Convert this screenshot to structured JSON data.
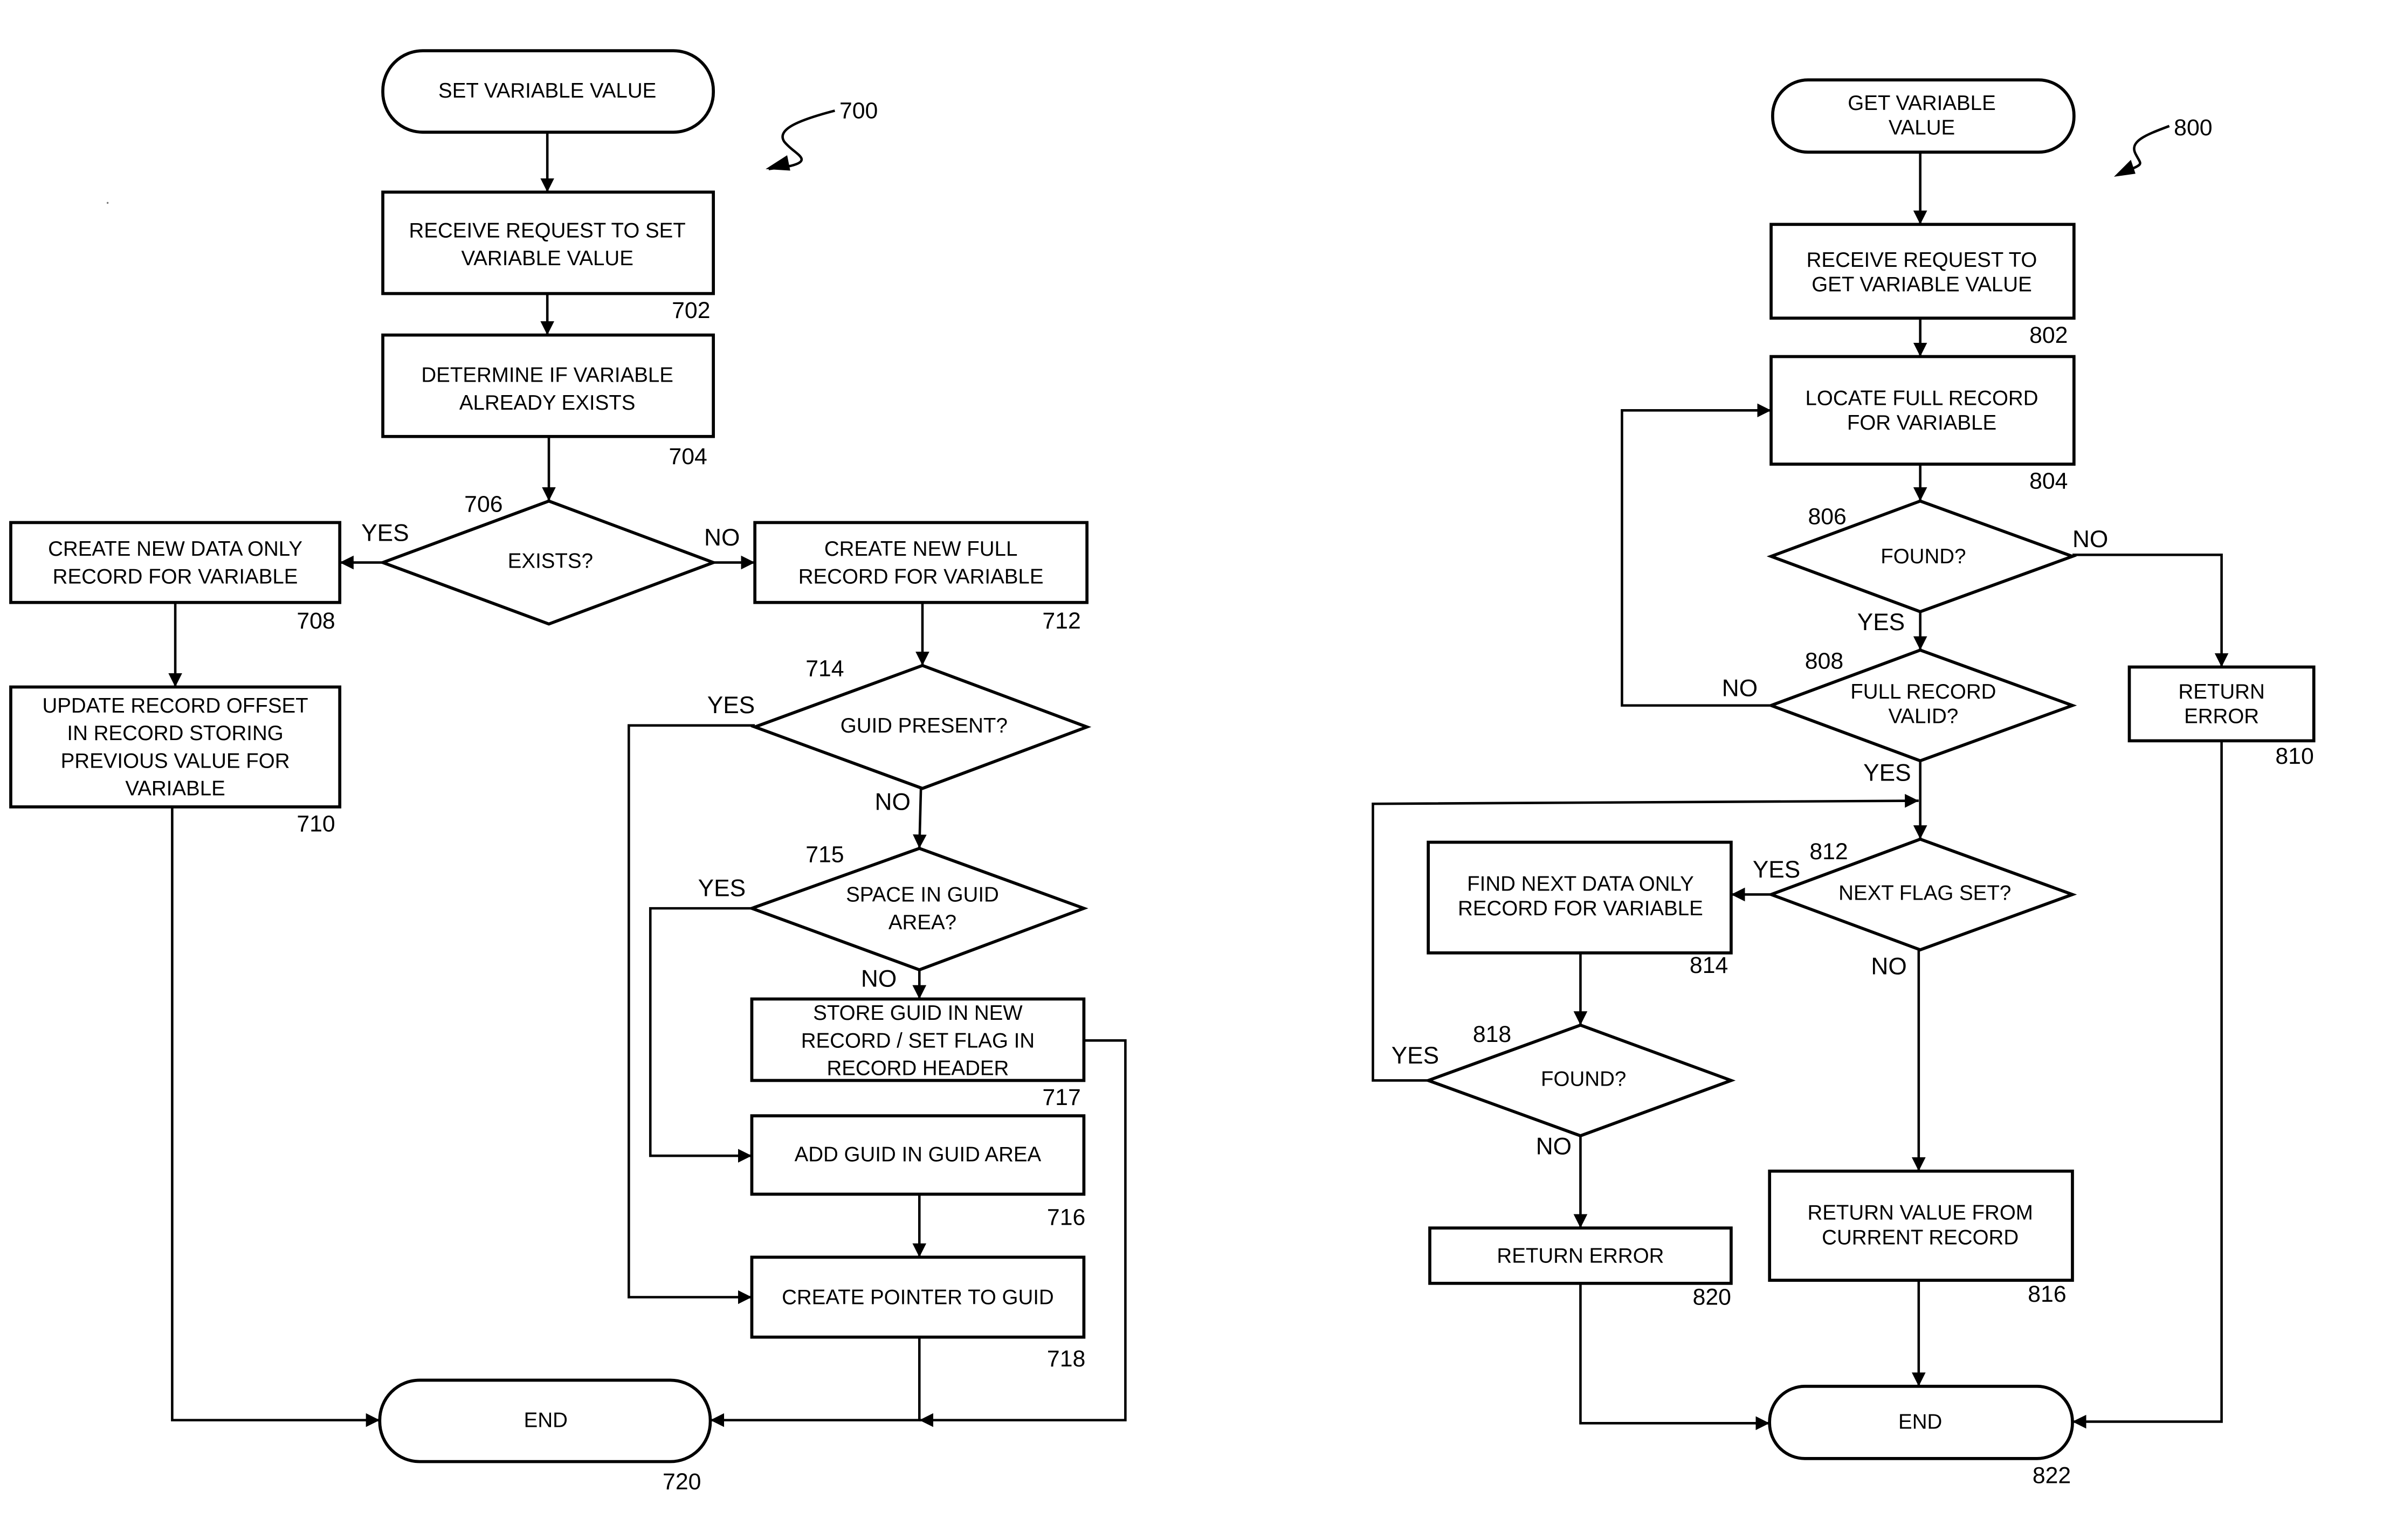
{
  "figures": [
    {
      "id": "700",
      "ref_label": "700",
      "nodes": {
        "start": {
          "text": [
            "SET VARIABLE VALUE"
          ]
        },
        "n702": {
          "text": [
            "RECEIVE REQUEST TO SET",
            "VARIABLE VALUE"
          ],
          "ref": "702"
        },
        "n704": {
          "text": [
            "DETERMINE IF VARIABLE",
            "ALREADY EXISTS"
          ],
          "ref": "704"
        },
        "n706": {
          "text": [
            "EXISTS?"
          ],
          "ref": "706"
        },
        "n708": {
          "text": [
            "CREATE NEW DATA ONLY",
            "RECORD FOR VARIABLE"
          ],
          "ref": "708"
        },
        "n710": {
          "text": [
            "UPDATE RECORD OFFSET",
            "IN RECORD STORING",
            "PREVIOUS VALUE FOR",
            "VARIABLE"
          ],
          "ref": "710"
        },
        "n712": {
          "text": [
            "CREATE NEW FULL",
            "RECORD FOR VARIABLE"
          ],
          "ref": "712"
        },
        "n714": {
          "text": [
            "GUID PRESENT?"
          ],
          "ref": "714"
        },
        "n715": {
          "text": [
            "SPACE IN GUID",
            "AREA?"
          ],
          "ref": "715"
        },
        "n717": {
          "text": [
            "STORE GUID IN NEW",
            "RECORD / SET FLAG IN",
            "RECORD HEADER"
          ],
          "ref": "717"
        },
        "n716": {
          "text": [
            "ADD GUID IN GUID AREA"
          ],
          "ref": "716"
        },
        "n718": {
          "text": [
            "CREATE POINTER TO GUID"
          ],
          "ref": "718"
        },
        "end": {
          "text": [
            "END"
          ],
          "ref": "720"
        }
      },
      "branch_labels": {
        "e706_yes": "YES",
        "e706_no": "NO",
        "e714_yes": "YES",
        "e714_no": "NO",
        "e715_yes": "YES",
        "e715_no": "NO"
      }
    },
    {
      "id": "800",
      "ref_label": "800",
      "nodes": {
        "start": {
          "text": [
            "GET VARIABLE",
            "VALUE"
          ]
        },
        "n802": {
          "text": [
            "RECEIVE REQUEST TO",
            "GET VARIABLE VALUE"
          ],
          "ref": "802"
        },
        "n804": {
          "text": [
            "LOCATE FULL RECORD",
            "FOR VARIABLE"
          ],
          "ref": "804"
        },
        "n806": {
          "text": [
            "FOUND?"
          ],
          "ref": "806"
        },
        "n808": {
          "text": [
            "FULL RECORD",
            "VALID?"
          ],
          "ref": "808"
        },
        "n810": {
          "text": [
            "RETURN",
            "ERROR"
          ],
          "ref": "810"
        },
        "n812": {
          "text": [
            "NEXT FLAG SET?"
          ],
          "ref": "812"
        },
        "n814": {
          "text": [
            "FIND NEXT DATA ONLY",
            "RECORD FOR VARIABLE"
          ],
          "ref": "814"
        },
        "n818": {
          "text": [
            "FOUND?"
          ],
          "ref": "818"
        },
        "n820": {
          "text": [
            "RETURN ERROR"
          ],
          "ref": "820"
        },
        "n816": {
          "text": [
            "RETURN VALUE FROM",
            "CURRENT RECORD"
          ],
          "ref": "816"
        },
        "end": {
          "text": [
            "END"
          ],
          "ref": "822"
        }
      },
      "branch_labels": {
        "e806_no": "NO",
        "e806_yes": "YES",
        "e808_no": "NO",
        "e808_yes": "YES",
        "e812_yes": "YES",
        "e812_no": "NO",
        "e818_yes": "YES",
        "e818_no": "NO"
      }
    }
  ]
}
